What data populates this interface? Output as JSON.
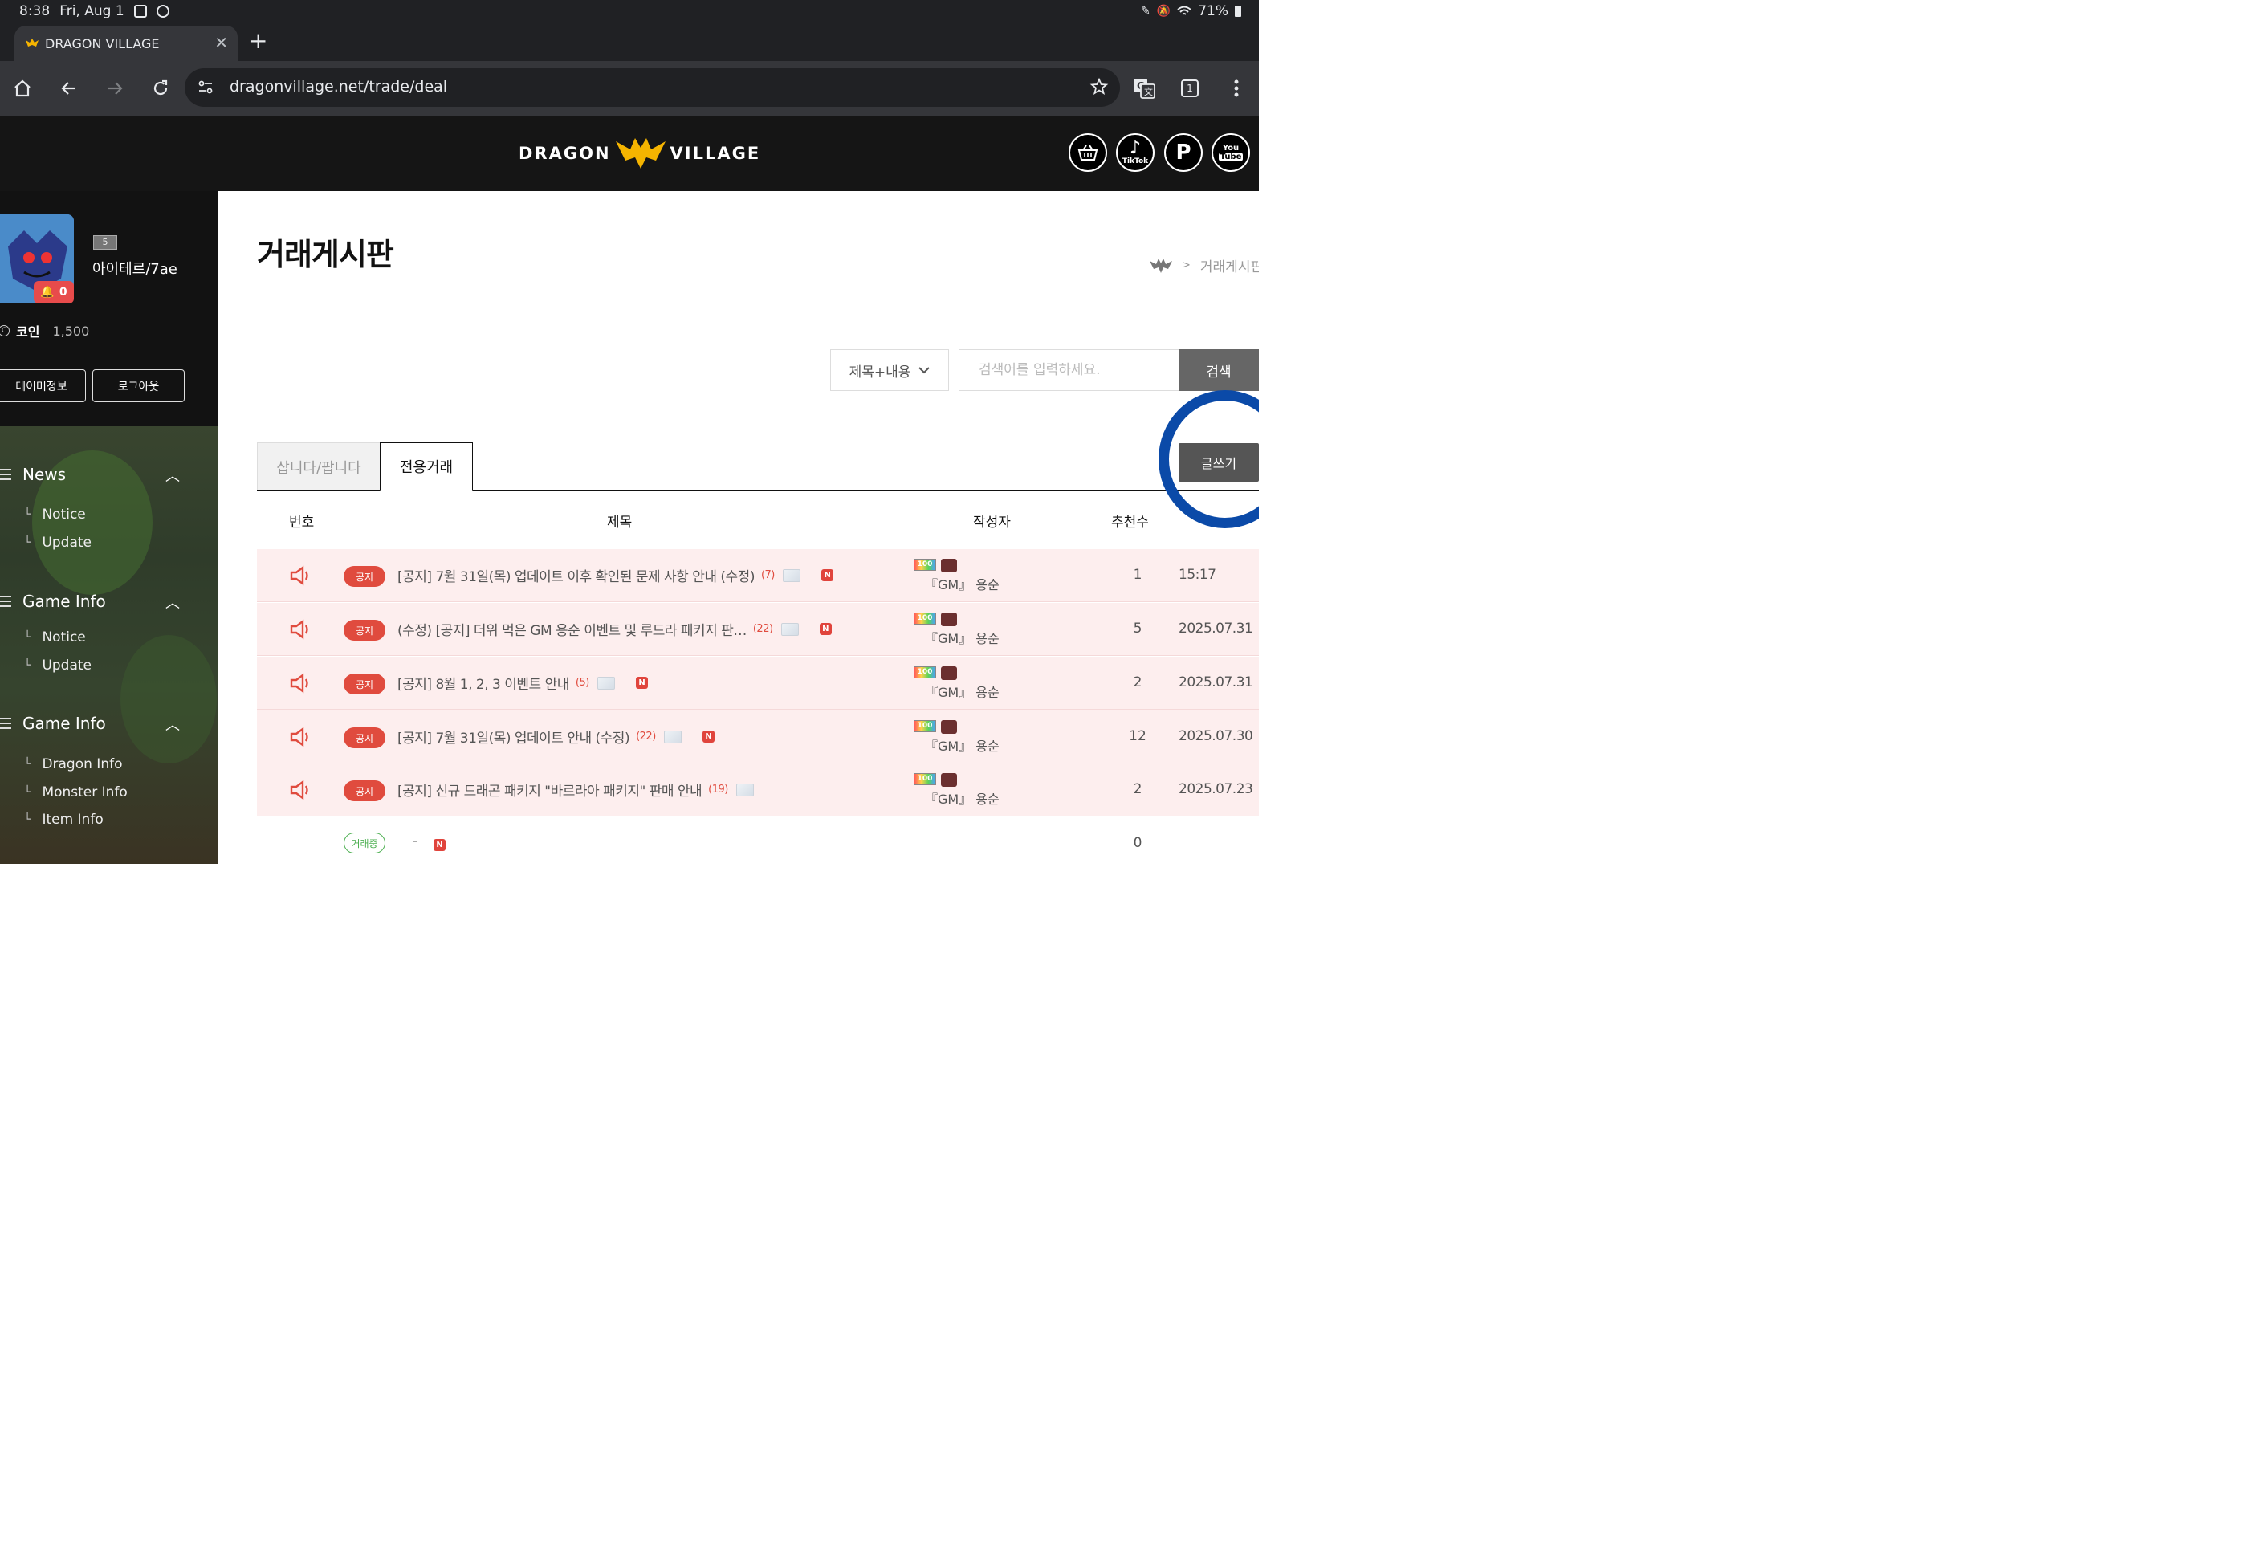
{
  "status_bar": {
    "time": "8:38",
    "date": "Fri, Aug 1",
    "battery": "71%"
  },
  "browser": {
    "tab_title": "DRAGON VILLAGE",
    "url": "dragonvillage.net/trade/deal",
    "tab_count": "1"
  },
  "site": {
    "logo_left": "DRAGON",
    "logo_right": "VILLAGE",
    "social": {
      "tiktok": "TikTok",
      "youtube_top": "You",
      "youtube_bottom": "Tube"
    }
  },
  "profile": {
    "level": "5",
    "username": "아이테르/7ae",
    "notifications": "0",
    "coin_label": "코인",
    "coin_value": "1,500",
    "tamer_button": "테이머정보",
    "logout_button": "로그아웃"
  },
  "sidebar": {
    "sections": [
      {
        "title": "News",
        "items": [
          "Notice",
          "Update"
        ]
      },
      {
        "title": "Game Info",
        "items": [
          "Notice",
          "Update"
        ]
      },
      {
        "title": "Game Info",
        "items": [
          "Dragon Info",
          "Monster Info",
          "Item Info"
        ]
      }
    ]
  },
  "main": {
    "page_title": "거래게시판",
    "breadcrumb": "거래게시판",
    "search_scope": "제목+내용",
    "search_placeholder": "검색어를 입력하세요.",
    "search_button": "검색",
    "tabs": [
      "삽니다/팝니다",
      "전용거래"
    ],
    "write_button": "글쓰기",
    "columns": {
      "no": "번호",
      "title": "제목",
      "author": "작성자",
      "votes": "추천수"
    },
    "rows": [
      {
        "badge": "공지",
        "title": "[공지] 7월 31일(목) 업데이트 이후 확인된 문제 사항 안내 (수정)",
        "comments": "(7)",
        "author": "『GM』 용순",
        "votes": "1",
        "date": "15:17"
      },
      {
        "badge": "공지",
        "title": "(수정) [공지] 더위 먹은 GM 용순 이벤트 및 루드라 패키지 판…",
        "comments": "(22)",
        "author": "『GM』 용순",
        "votes": "5",
        "date": "2025.07.31"
      },
      {
        "badge": "공지",
        "title": "[공지] 8월 1, 2, 3 이벤트 안내",
        "comments": "(5)",
        "author": "『GM』 용순",
        "votes": "2",
        "date": "2025.07.31"
      },
      {
        "badge": "공지",
        "title": "[공지] 7월 31일(목) 업데이트 안내 (수정)",
        "comments": "(22)",
        "author": "『GM』 용순",
        "votes": "12",
        "date": "2025.07.30"
      },
      {
        "badge": "공지",
        "title": "[공지] 신규 드래곤 패키지 \"바르라아 패키지\" 판매 안내",
        "comments": "(19)",
        "author": "『GM』 용순",
        "votes": "2",
        "date": "2025.07.23"
      }
    ],
    "last_row": {
      "badge": "거래중",
      "dash": "-",
      "votes": "0"
    },
    "new_badge": "N",
    "hundred_badge": "100"
  },
  "colors": {
    "notice_row_bg": "#fdeeee",
    "notice_badge": "#e04b3e",
    "annotation_circle": "#0b4aa8",
    "trade_badge": "#4caf50"
  }
}
